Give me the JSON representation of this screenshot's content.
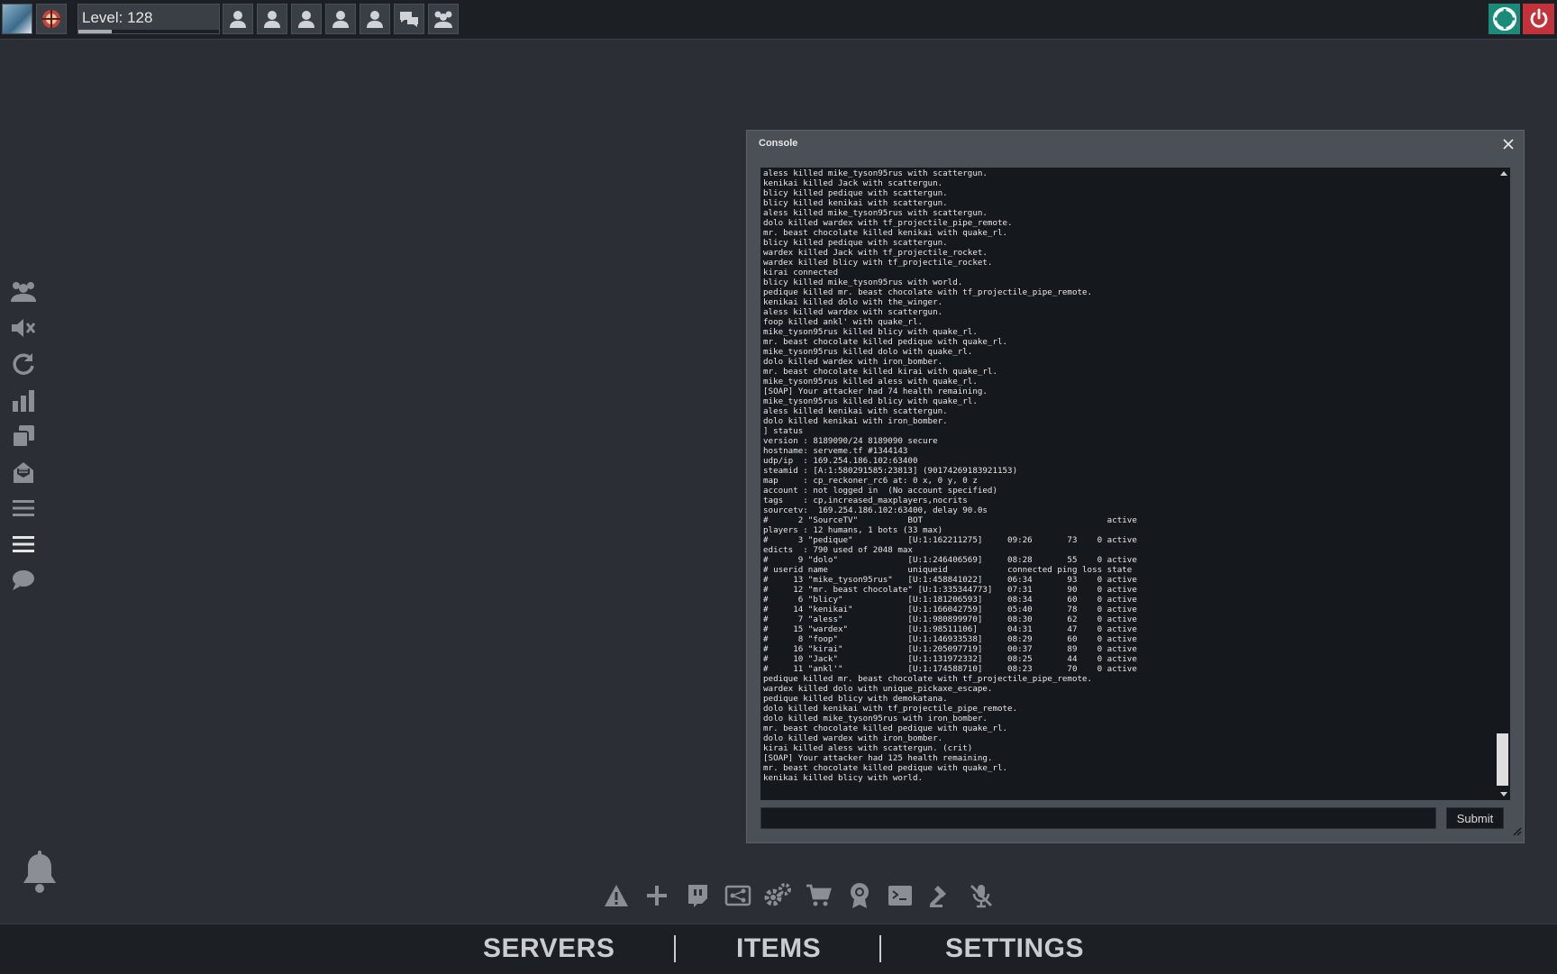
{
  "topbar": {
    "level_label": "Level: 128",
    "level_progress": 0.24,
    "friend_slots": [
      "player-slot",
      "player-slot",
      "player-slot",
      "player-slot",
      "player-slot"
    ]
  },
  "colors": {
    "topbar_bg": "#1c1f23",
    "page_bg": "#2b2f35",
    "support_button": "#1a8a7a",
    "power_button": "#c1323a",
    "console_bg": "#4b5056",
    "console_output_bg": "#15181c"
  },
  "console": {
    "title": "Console",
    "lines": [
      "aless killed mike_tyson95rus with scattergun.",
      "kenikai killed Jack with scattergun.",
      "blicy killed pedique with scattergun.",
      "blicy killed kenikai with scattergun.",
      "aless killed mike_tyson95rus with scattergun.",
      "dolo killed wardex with tf_projectile_pipe_remote.",
      "mr. beast chocolate killed kenikai with quake_rl.",
      "blicy killed pedique with scattergun.",
      "wardex killed Jack with tf_projectile_rocket.",
      "wardex killed blicy with tf_projectile_rocket.",
      "kirai connected",
      "blicy killed mike_tyson95rus with world.",
      "pedique killed mr. beast chocolate with tf_projectile_pipe_remote.",
      "kenikai killed dolo with the_winger.",
      "aless killed wardex with scattergun.",
      "foop killed ankl' with quake_rl.",
      "mike_tyson95rus killed blicy with quake_rl.",
      "mr. beast chocolate killed pedique with quake_rl.",
      "mike_tyson95rus killed dolo with quake_rl.",
      "dolo killed wardex with iron_bomber.",
      "mr. beast chocolate killed kirai with quake_rl.",
      "mike_tyson95rus killed aless with quake_rl.",
      "[SOAP] Your attacker had 74 health remaining.",
      "mike_tyson95rus killed blicy with quake_rl.",
      "aless killed kenikai with scattergun.",
      "dolo killed kenikai with iron_bomber.",
      "] status",
      "version : 8189090/24 8189090 secure",
      "hostname: serveme.tf #1344143",
      "udp/ip  : 169.254.186.102:63400",
      "steamid : [A:1:580291585:23813] (90174269183921153)",
      "map     : cp_reckoner_rc6 at: 0 x, 0 y, 0 z",
      "account : not logged in  (No account specified)",
      "tags    : cp,increased_maxplayers,nocrits",
      "sourcetv:  169.254.186.102:63400, delay 90.0s",
      "#      2 \"SourceTV\"          BOT                                     active",
      "players : 12 humans, 1 bots (33 max)",
      "#      3 \"pedique\"           [U:1:162211275]     09:26       73    0 active",
      "edicts  : 790 used of 2048 max",
      "#      9 \"dolo\"              [U:1:246406569]     08:28       55    0 active",
      "# userid name                uniqueid            connected ping loss state",
      "#     13 \"mike_tyson95rus\"   [U:1:458841022]     06:34       93    0 active",
      "#     12 \"mr. beast chocolate\" [U:1:335344773]   07:31       90    0 active",
      "#      6 \"blicy\"             [U:1:181206593]     08:34       60    0 active",
      "#     14 \"kenikai\"           [U:1:166042759]     05:40       78    0 active",
      "#      7 \"aless\"             [U:1:980899970]     08:30       62    0 active",
      "#     15 \"wardex\"            [U:1:98511106]      04:31       47    0 active",
      "#      8 \"foop\"              [U:1:146933538]     08:29       60    0 active",
      "#     16 \"kirai\"             [U:1:205097719]     00:37       89    0 active",
      "#     10 \"Jack\"              [U:1:131972332]     08:25       44    0 active",
      "#     11 \"ankl'\"             [U:1:174588710]     08:23       70    0 active",
      "pedique killed mr. beast chocolate with tf_projectile_pipe_remote.",
      "wardex killed dolo with unique_pickaxe_escape.",
      "pedique killed blicy with demokatana.",
      "dolo killed kenikai with tf_projectile_pipe_remote.",
      "dolo killed mike_tyson95rus with iron_bomber.",
      "mr. beast chocolate killed pedique with quake_rl.",
      "dolo killed wardex with iron_bomber.",
      "kirai killed aless with scattergun. (crit)",
      "[SOAP] Your attacker had 125 health remaining.",
      "mr. beast chocolate killed pedique with quake_rl.",
      "kenikai killed blicy with world."
    ],
    "input_value": "",
    "submit_label": "Submit"
  },
  "sidebar": {
    "icons": [
      "party-icon",
      "mute-icon",
      "refresh-icon",
      "stats-icon",
      "copy-icon",
      "inbox-icon",
      "menu-icon",
      "list-icon",
      "chat-icon"
    ]
  },
  "bottom_toolbar": {
    "icons": [
      "warning-icon",
      "plus-icon",
      "twitch-icon",
      "network-icon",
      "gears-icon",
      "cart-icon",
      "badge-icon",
      "terminal-icon",
      "hammer-icon",
      "mic-off-icon"
    ]
  },
  "bottom_nav": {
    "servers": "SERVERS",
    "items": "ITEMS",
    "settings": "SETTINGS"
  }
}
